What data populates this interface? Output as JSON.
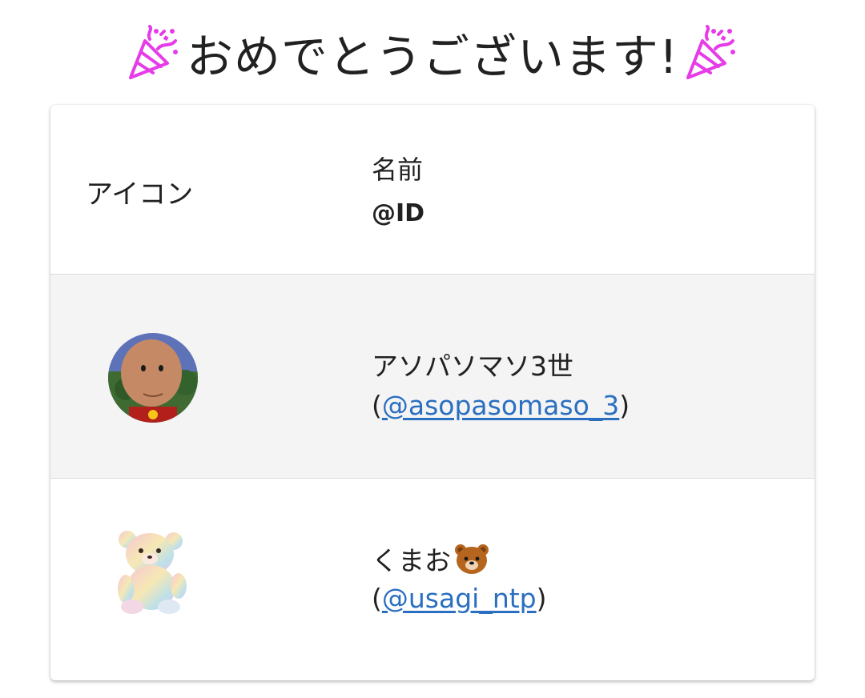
{
  "header": {
    "title": "おめでとうございます!",
    "title_icon": "party-popper-icon",
    "icon_color": "#e63ce8"
  },
  "table": {
    "columns": {
      "icon": "アイコン",
      "name": "名前",
      "id": "@ID"
    },
    "rows": [
      {
        "name": "アソパソマソ3世",
        "handle_open": "(",
        "handle": "@asopasomaso_3",
        "handle_close": ")",
        "avatar": "round-cartoon-face-avatar"
      },
      {
        "name": "くまお",
        "name_emoji": "bear-face-icon",
        "handle_open": "(",
        "handle": "@usagi_ntp",
        "handle_close": ")",
        "avatar": "pastel-teddy-bear-avatar"
      }
    ]
  },
  "colors": {
    "link": "#2a6fc0",
    "stripe": "#f4f4f4",
    "text": "#212121"
  }
}
